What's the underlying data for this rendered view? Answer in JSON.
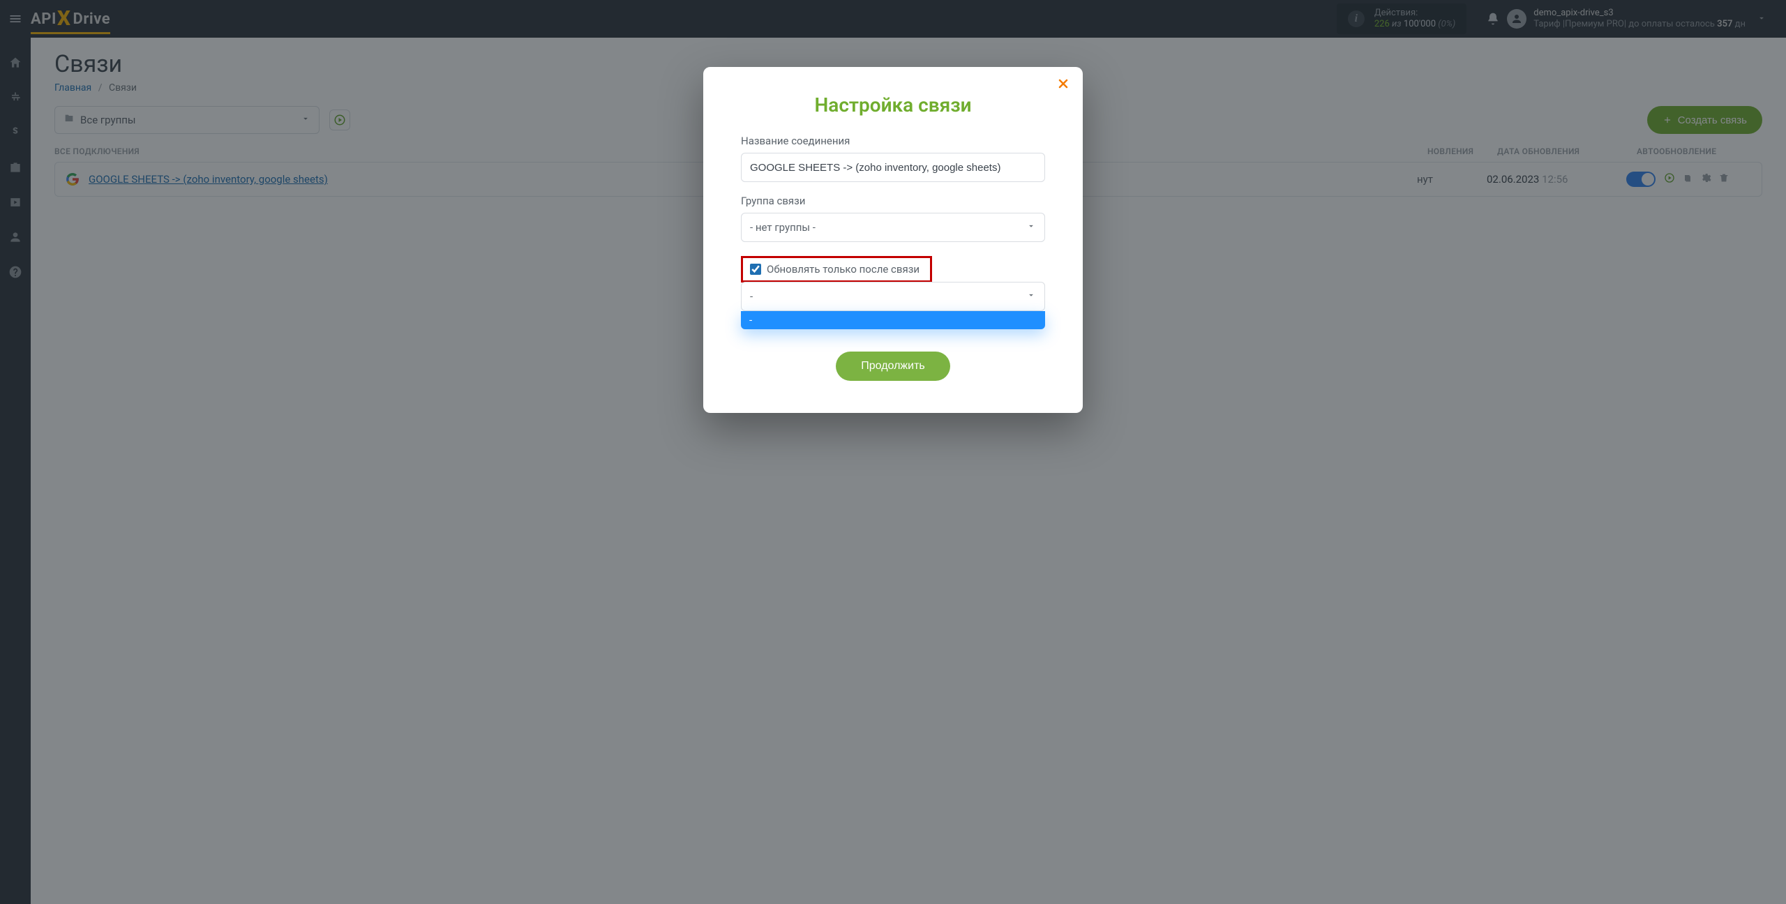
{
  "header": {
    "actions_label": "Действия:",
    "actions_used": "226",
    "actions_of": "из",
    "actions_total": "100'000",
    "actions_pct": "(0%)",
    "user_name": "demo_apix-drive_s3",
    "tariff_prefix": "Тариф |Премиум PRO|  до оплаты осталось ",
    "tariff_days": "357",
    "tariff_suffix": " дн"
  },
  "page": {
    "title": "Связи",
    "breadcrumb_home": "Главная",
    "breadcrumb_current": "Связи",
    "group_select": "Все группы",
    "create_btn": "Создать связь",
    "th_all": "ВСЕ ПОДКЛЮЧЕНИЯ",
    "th_update": "НОВЛЕНИЯ",
    "th_date": "ДАТА ОБНОВЛЕНИЯ",
    "th_auto": "АВТООБНОВЛЕНИЕ"
  },
  "row": {
    "name": "GOOGLE SHEETS -> (zoho inventory, google sheets)",
    "upd": "нут",
    "date": "02.06.2023",
    "time": "12:56"
  },
  "modal": {
    "title": "Настройка связи",
    "label_name": "Название соединения",
    "input_name": "GOOGLE SHEETS -> (zoho inventory, google sheets)",
    "label_group": "Группа связи",
    "group_value": "- нет группы -",
    "checkbox": "Обновлять только после связи",
    "after_value": "-",
    "dropdown_item": "-",
    "continue": "Продолжить"
  }
}
